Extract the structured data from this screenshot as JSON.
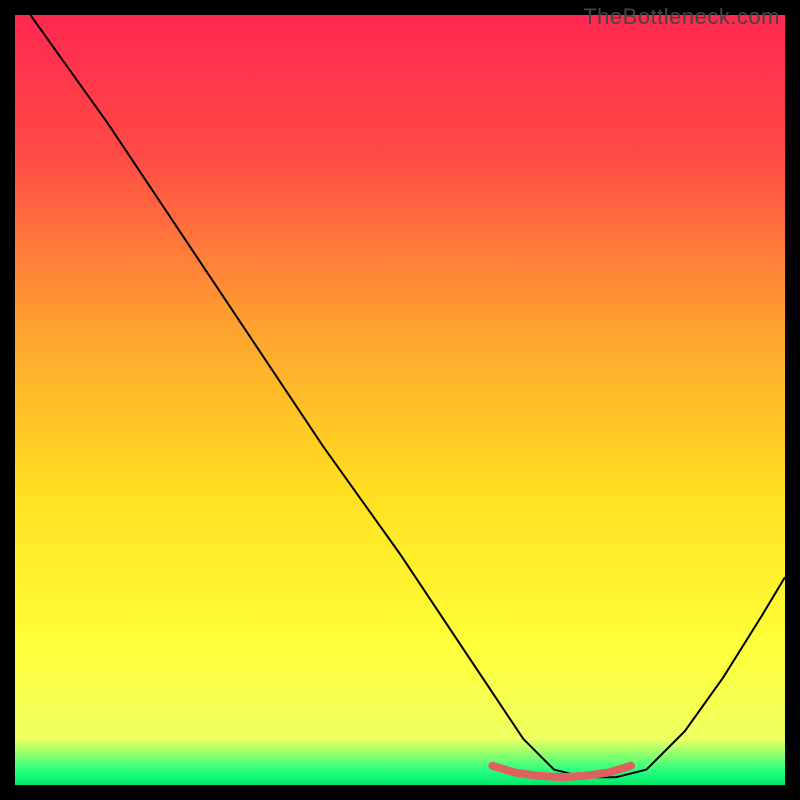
{
  "watermark": "TheBottleneck.com",
  "chart_data": {
    "type": "line",
    "title": "",
    "xlabel": "",
    "ylabel": "",
    "xlim": [
      0,
      100
    ],
    "ylim": [
      0,
      100
    ],
    "background_gradient": {
      "stops": [
        {
          "offset": 0.0,
          "color": "#ff2850"
        },
        {
          "offset": 0.18,
          "color": "#ff4a46"
        },
        {
          "offset": 0.4,
          "color": "#ffa030"
        },
        {
          "offset": 0.62,
          "color": "#ffe020"
        },
        {
          "offset": 0.82,
          "color": "#ffff3a"
        },
        {
          "offset": 0.94,
          "color": "#eeff60"
        },
        {
          "offset": 0.983,
          "color": "#20ff80"
        },
        {
          "offset": 1.0,
          "color": "#00e868"
        }
      ]
    },
    "series": [
      {
        "name": "bottleneck-curve",
        "color": "#000000",
        "width": 2,
        "x": [
          2,
          7,
          12,
          20,
          30,
          40,
          50,
          58,
          62,
          66,
          70,
          74,
          78,
          82,
          87,
          92,
          97,
          100
        ],
        "values": [
          100,
          93,
          86,
          74,
          59,
          44,
          30,
          18,
          12,
          6,
          2,
          1,
          1,
          2,
          7,
          14,
          22,
          27
        ]
      },
      {
        "name": "optimal-band",
        "color": "#e06060",
        "width": 8,
        "x": [
          62,
          65,
          68,
          71,
          74,
          77,
          80
        ],
        "values": [
          2.5,
          1.6,
          1.2,
          1.0,
          1.2,
          1.6,
          2.5
        ]
      }
    ]
  }
}
